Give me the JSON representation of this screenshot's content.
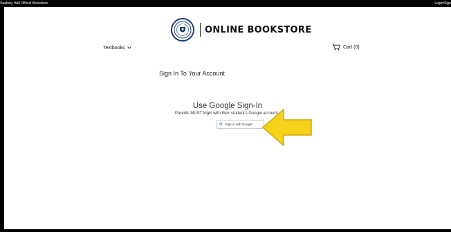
{
  "topbar": {
    "store_name": "Seabury Hall Official Bookstore",
    "login_label": "Login/Sign"
  },
  "header": {
    "logo_text": "ONLINE BOOKSTORE"
  },
  "nav": {
    "textbooks_label": "Textbooks",
    "cart_label": "Cart (0)"
  },
  "main": {
    "signin_title": "Sign In To Your Account",
    "google_title": "Use Google Sign-In",
    "google_subtitle": "Parents MUST login with their student's Google account",
    "google_button_label": "Sign in with Google"
  },
  "colors": {
    "arrow_fill": "#f7d21a",
    "arrow_stroke": "#c9a90d",
    "seal_blue": "#1f3b73"
  },
  "icons": [
    "chevron-down-icon",
    "cart-icon",
    "google-g-icon",
    "school-seal-icon",
    "arrow-pointer-icon"
  ]
}
